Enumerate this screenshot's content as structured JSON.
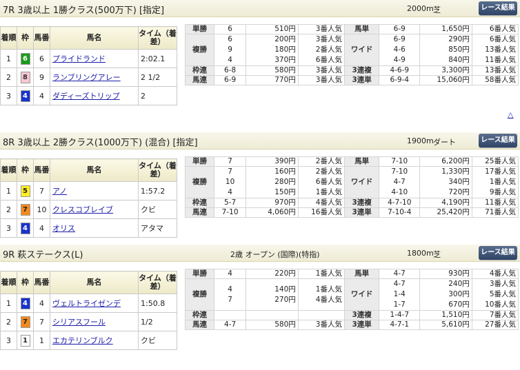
{
  "colors": {
    "header_bg": "#efeed8",
    "button_bg": "#3a5070",
    "frame_6": "#1a9a1a",
    "frame_8": "#f6c7d2",
    "frame_4": "#1a33cc",
    "frame_5": "#ffee22",
    "frame_7": "#f48a1c",
    "frame_1": "#ffffff",
    "link": "#1a1aa8"
  },
  "results_button_label": "レース結果",
  "up_arrow": "△",
  "result_headers": {
    "finish": "着順",
    "frame": "枠",
    "number": "馬番",
    "horse": "馬名",
    "time": "タイム（着差）"
  },
  "pay_labels": {
    "win": "単勝",
    "place": "複勝",
    "bracket": "枠連",
    "quinella": "馬連",
    "exacta": "馬単",
    "wide": "ワイド",
    "trio": "3連複",
    "trifecta": "3連単"
  },
  "races": [
    {
      "title": "7R 3歳以上 1勝クラス(500万下) [指定]",
      "condition": "",
      "distance": "2000m",
      "surface": "芝",
      "results": [
        {
          "pos": "1",
          "frame": "6",
          "frame_color": "#1a9a1a",
          "frame_text": "#ffffff",
          "num": "6",
          "horse": "プライドランド",
          "time": "2:02.1"
        },
        {
          "pos": "2",
          "frame": "8",
          "frame_color": "#f6c7d2",
          "frame_text": "#333333",
          "num": "9",
          "horse": "ランブリングアレー",
          "time": "2 1/2"
        },
        {
          "pos": "3",
          "frame": "4",
          "frame_color": "#1a33cc",
          "frame_text": "#ffffff",
          "num": "4",
          "horse": "ダディーズトリップ",
          "time": "2"
        }
      ],
      "win": {
        "combo": "6",
        "amount": "510円",
        "pop": "3番人気"
      },
      "place": {
        "combos": "6\n9\n4",
        "amounts": "200円\n180円\n370円",
        "pops": "3番人気\n2番人気\n6番人気"
      },
      "bracket": {
        "combo": "6-8",
        "amount": "580円",
        "pop": "3番人気"
      },
      "quinella": {
        "combo": "6-9",
        "amount": "770円",
        "pop": "3番人気"
      },
      "exacta": {
        "combo": "6-9",
        "amount": "1,650円",
        "pop": "6番人気"
      },
      "wide": {
        "combos": "6-9\n4-6\n4-9",
        "amounts": "290円\n850円\n840円",
        "pops": "6番人気\n13番人気\n11番人気"
      },
      "trio": {
        "combo": "4-6-9",
        "amount": "3,300円",
        "pop": "13番人気"
      },
      "trifecta": {
        "combo": "6-9-4",
        "amount": "15,060円",
        "pop": "58番人気"
      }
    },
    {
      "title": "8R 3歳以上 2勝クラス(1000万下) (混合) [指定]",
      "condition": "",
      "distance": "1900m",
      "surface": "ダート",
      "results": [
        {
          "pos": "1",
          "frame": "5",
          "frame_color": "#ffee22",
          "frame_text": "#222222",
          "num": "7",
          "horse": "アノ",
          "time": "1:57.2"
        },
        {
          "pos": "2",
          "frame": "7",
          "frame_color": "#f48a1c",
          "frame_text": "#222222",
          "num": "10",
          "horse": "クレスコブレイブ",
          "time": "クビ"
        },
        {
          "pos": "3",
          "frame": "4",
          "frame_color": "#1a33cc",
          "frame_text": "#ffffff",
          "num": "4",
          "horse": "オリス",
          "time": "アタマ"
        }
      ],
      "win": {
        "combo": "7",
        "amount": "390円",
        "pop": "2番人気"
      },
      "place": {
        "combos": "7\n10\n4",
        "amounts": "160円\n280円\n150円",
        "pops": "2番人気\n6番人気\n1番人気"
      },
      "bracket": {
        "combo": "5-7",
        "amount": "970円",
        "pop": "4番人気"
      },
      "quinella": {
        "combo": "7-10",
        "amount": "4,060円",
        "pop": "16番人気"
      },
      "exacta": {
        "combo": "7-10",
        "amount": "6,200円",
        "pop": "25番人気"
      },
      "wide": {
        "combos": "7-10\n4-7\n4-10",
        "amounts": "1,330円\n340円\n720円",
        "pops": "17番人気\n1番人気\n9番人気"
      },
      "trio": {
        "combo": "4-7-10",
        "amount": "4,190円",
        "pop": "11番人気"
      },
      "trifecta": {
        "combo": "7-10-4",
        "amount": "25,420円",
        "pop": "71番人気"
      }
    },
    {
      "title": "9R 萩ステークス(L)",
      "condition": "2歳 オープン (国際)(特指)",
      "distance": "1800m",
      "surface": "芝",
      "results": [
        {
          "pos": "1",
          "frame": "4",
          "frame_color": "#1a33cc",
          "frame_text": "#ffffff",
          "num": "4",
          "horse": "ヴェルトライゼンデ",
          "time": "1:50.8"
        },
        {
          "pos": "2",
          "frame": "7",
          "frame_color": "#f48a1c",
          "frame_text": "#222222",
          "num": "7",
          "horse": "シリアスフール",
          "time": "1/2"
        },
        {
          "pos": "3",
          "frame": "1",
          "frame_color": "#ffffff",
          "frame_text": "#222222",
          "num": "1",
          "horse": "エカテリンブルク",
          "time": "クビ"
        }
      ],
      "win": {
        "combo": "4",
        "amount": "220円",
        "pop": "1番人気"
      },
      "place": {
        "combos": "4\n7",
        "amounts": "140円\n270円",
        "pops": "1番人気\n4番人気"
      },
      "bracket": {
        "combo": "",
        "amount": "",
        "pop": ""
      },
      "quinella": {
        "combo": "4-7",
        "amount": "580円",
        "pop": "3番人気"
      },
      "exacta": {
        "combo": "4-7",
        "amount": "930円",
        "pop": "4番人気"
      },
      "wide": {
        "combos": "4-7\n1-4\n1-7",
        "amounts": "240円\n300円\n670円",
        "pops": "3番人気\n5番人気\n10番人気"
      },
      "trio": {
        "combo": "1-4-7",
        "amount": "1,510円",
        "pop": "7番人気"
      },
      "trifecta": {
        "combo": "4-7-1",
        "amount": "5,610円",
        "pop": "27番人気"
      }
    }
  ]
}
